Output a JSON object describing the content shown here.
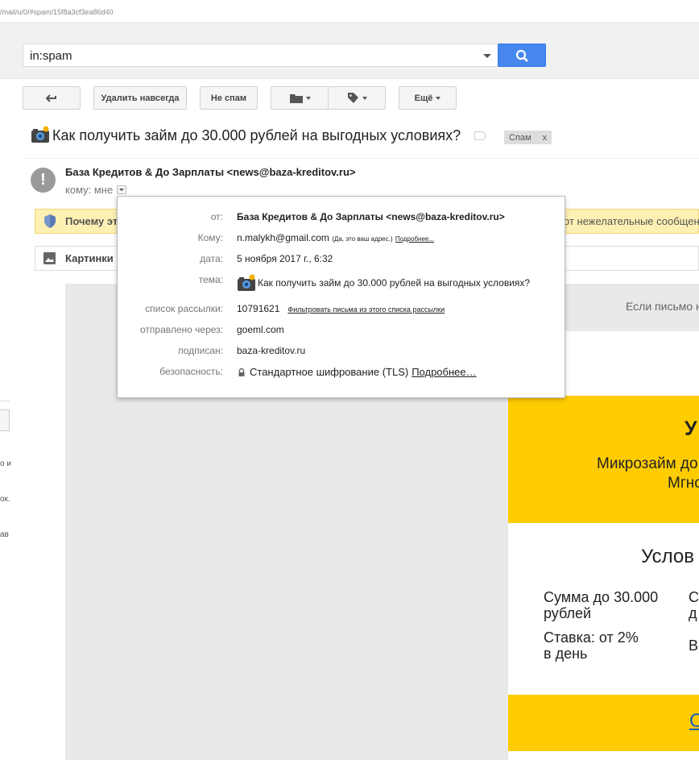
{
  "url": "/mail/u/0/#spam/15f8a3cf3ea86d40",
  "search": {
    "value": "in:spam"
  },
  "toolbar": {
    "delete_forever": "Удалить навсегда",
    "not_spam": "Не спам",
    "more": "Ещё"
  },
  "message": {
    "subject": "Как получить займ до 30.000 рублей на выгодных условиях?",
    "label_chip": "Спам",
    "label_chip_close": "x",
    "sender": "База Кредитов & До Зарплаты <news@baza-kreditov.ru>",
    "to": "кому: мне"
  },
  "warning": {
    "text": "Почему эт",
    "right_text": "от нежелательные сообщен"
  },
  "images_bar": {
    "text": "Картинки"
  },
  "details": {
    "from_label": "от:",
    "from_value": "База Кредитов & До Зарплаты <news@baza-kreditov.ru>",
    "to_label": "Кому:",
    "to_value": "n.malykh@gmail.com",
    "to_note": "(Да, это ваш адрес.)",
    "to_more": "Подробнее...",
    "date_label": "дата:",
    "date_value": "5 ноября 2017 г., 6:32",
    "subject_label": "тема:",
    "subject_value": "Как получить займ до 30.000 рублей на выгодных условиях?",
    "list_label": "список рассылки:",
    "list_value": "10791621",
    "list_filter": "Фильтровать письма из этого списка рассылки",
    "via_label": "отправлено через:",
    "via_value": "goeml.com",
    "signed_label": "подписан:",
    "signed_value": "baza-kreditov.ru",
    "security_label": "безопасность:",
    "security_value": "Стандартное шифрование (TLS)",
    "security_more": "Подробнее…"
  },
  "left_fragments": [
    "о и",
    "ок.",
    "ав"
  ],
  "body": {
    "open_hint": "Если письмо н",
    "headline": "У",
    "line1": "Микрозайм до",
    "line2": "Мгно",
    "conditions_title": "Услов",
    "cond1": "Сумма до 30.000 рублей",
    "cond2": "С д",
    "cond3": "Ставка: от 2% в день",
    "cond4": "В",
    "cta": "С"
  }
}
